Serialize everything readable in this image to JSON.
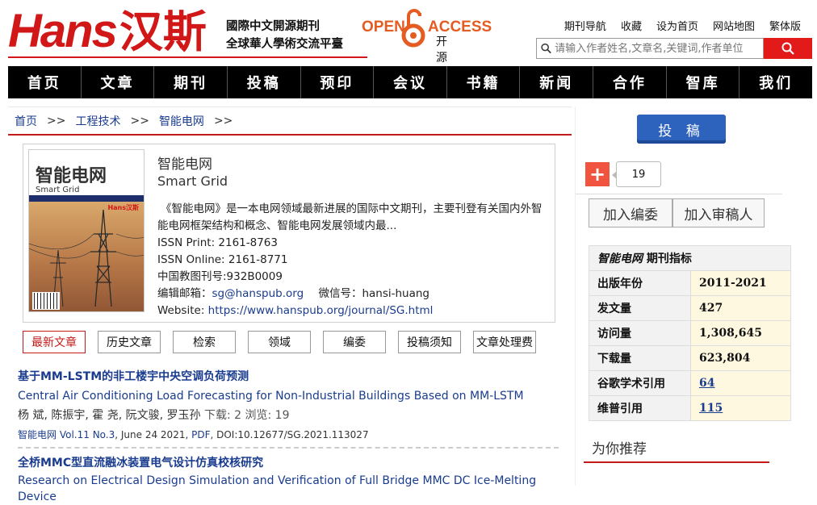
{
  "header": {
    "logo_en": "Hans",
    "logo_cn": "汉斯",
    "tagline_1": "國際中文開源期刊",
    "tagline_2": "全球華人學術交流平臺",
    "oa_open": "OPEN",
    "oa_access": "ACCESS",
    "oa_sub": "开源期刊",
    "top_links": [
      "期刊导航",
      "收藏",
      "设为首页",
      "网站地图",
      "繁体版"
    ],
    "search_placeholder": "请输入作者姓名,文章名,关键词,作者单位"
  },
  "nav": [
    "首页",
    "文章",
    "期刊",
    "投稿",
    "预印",
    "会议",
    "书籍",
    "新闻",
    "合作",
    "智库",
    "我们"
  ],
  "breadcrumb": [
    "首页",
    "工程技术",
    "智能电网"
  ],
  "breadcrumb_sep": ">>",
  "journal": {
    "cover_title": "智能电网",
    "cover_title_en": "Smart Grid",
    "cover_brand": "Hans汉斯",
    "name_cn": "智能电网",
    "name_en": "Smart Grid",
    "description": "《智能电网》是一本电网领域最新进展的国际中文期刊，主要刊登有关国内外智能电网框架结构和概念、智能电网发展领域内最...",
    "issn_print": "ISSN Print: 2161-8763",
    "issn_online": "ISSN Online: 2161-8771",
    "cn_number": "中国教图刊号:932B0009",
    "email_label": "编辑邮箱：",
    "email": "sg@hanspub.org",
    "wechat": "微信号：hansi-huang",
    "website_label": "Website: ",
    "website": "https://www.hanspub.org/journal/SG.html"
  },
  "tabs": [
    "最新文章",
    "历史文章",
    "检索",
    "领域",
    "编委",
    "投稿须知",
    "文章处理费"
  ],
  "articles": [
    {
      "title_cn": "基于MM-LSTM的非工楼宇中央空调负荷预测",
      "title_en": "Central Air Conditioning Load Forecasting for Non-Industrial Buildings Based on MM-LSTM",
      "authors": "杨 斌, 陈振宇, 霍 尧, 阮文骏, 罗玉孙",
      "meta": "下载: 2  浏览: 19",
      "journal": "智能电网",
      "volume": "Vol.11 No.3",
      "date": ", June 24 2021, ",
      "pdf": "PDF",
      "doi": ", DOI:10.12677/SG.2021.113027"
    },
    {
      "title_cn": "全桥MMC型直流融冰装置电气设计仿真校核研究",
      "title_en": "Research on Electrical Design Simulation and Verification of Full Bridge MMC DC Ice-Melting Device"
    }
  ],
  "sidebar": {
    "submit_button": "投 稿",
    "share_count": "19",
    "join_editor": "加入编委",
    "join_reviewer": "加入审稿人",
    "metrics_title_journal": "智能电网",
    "metrics_title": "期刊指标",
    "metrics": [
      {
        "label": "出版年份",
        "value": "2011-2021"
      },
      {
        "label": "发文量",
        "value": "427"
      },
      {
        "label": "访问量",
        "value": "1,308,645"
      },
      {
        "label": "下载量",
        "value": "623,804"
      },
      {
        "label": "谷歌学术引用",
        "value": "64"
      },
      {
        "label": "维普引用",
        "value": "115"
      }
    ],
    "recommend": "为你推荐"
  },
  "colors": {
    "brand_red": "#d11717",
    "link_blue": "#1a3c8f",
    "button_blue": "#2d62bd",
    "oa_orange": "#e55c22"
  }
}
